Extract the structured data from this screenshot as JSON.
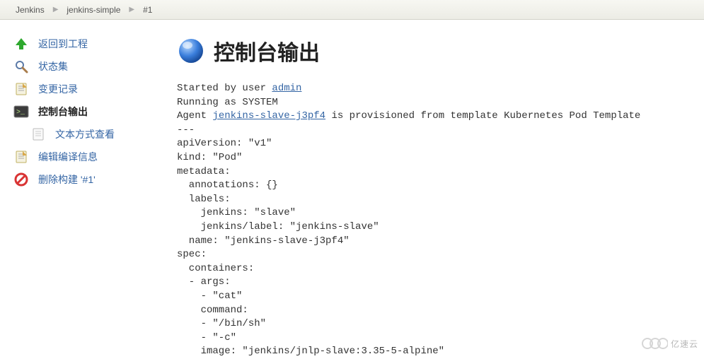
{
  "breadcrumb": {
    "items": [
      "Jenkins",
      "jenkins-simple",
      "#1"
    ]
  },
  "sidebar": {
    "items": [
      {
        "label": "返回到工程",
        "name": "back-to-project",
        "icon": "up",
        "active": false,
        "indent": false
      },
      {
        "label": "状态集",
        "name": "status",
        "icon": "search",
        "active": false,
        "indent": false
      },
      {
        "label": "变更记录",
        "name": "changes",
        "icon": "notepad",
        "active": false,
        "indent": false
      },
      {
        "label": "控制台输出",
        "name": "console-output",
        "icon": "terminal",
        "active": true,
        "indent": false
      },
      {
        "label": "文本方式查看",
        "name": "view-as-text",
        "icon": "document",
        "active": false,
        "indent": true
      },
      {
        "label": "编辑编译信息",
        "name": "edit-build-info",
        "icon": "notepad",
        "active": false,
        "indent": false
      },
      {
        "label": "删除构建 '#1'",
        "name": "delete-build",
        "icon": "forbidden",
        "active": false,
        "indent": false
      }
    ]
  },
  "page": {
    "title": "控制台输出"
  },
  "console": {
    "prefix1": "Started by user ",
    "userlink": "admin",
    "line_running": "Running as SYSTEM",
    "agent_prefix": "Agent ",
    "agent_link": "jenkins-slave-j3pf4",
    "agent_suffix": " is provisioned from template Kubernetes Pod Template",
    "rest": "---\napiVersion: \"v1\"\nkind: \"Pod\"\nmetadata:\n  annotations: {}\n  labels:\n    jenkins: \"slave\"\n    jenkins/label: \"jenkins-slave\"\n  name: \"jenkins-slave-j3pf4\"\nspec:\n  containers:\n  - args:\n    - \"cat\"\n    command:\n    - \"/bin/sh\"\n    - \"-c\"\n    image: \"jenkins/jnlp-slave:3.35-5-alpine\""
  },
  "watermark": {
    "text": "亿速云"
  }
}
